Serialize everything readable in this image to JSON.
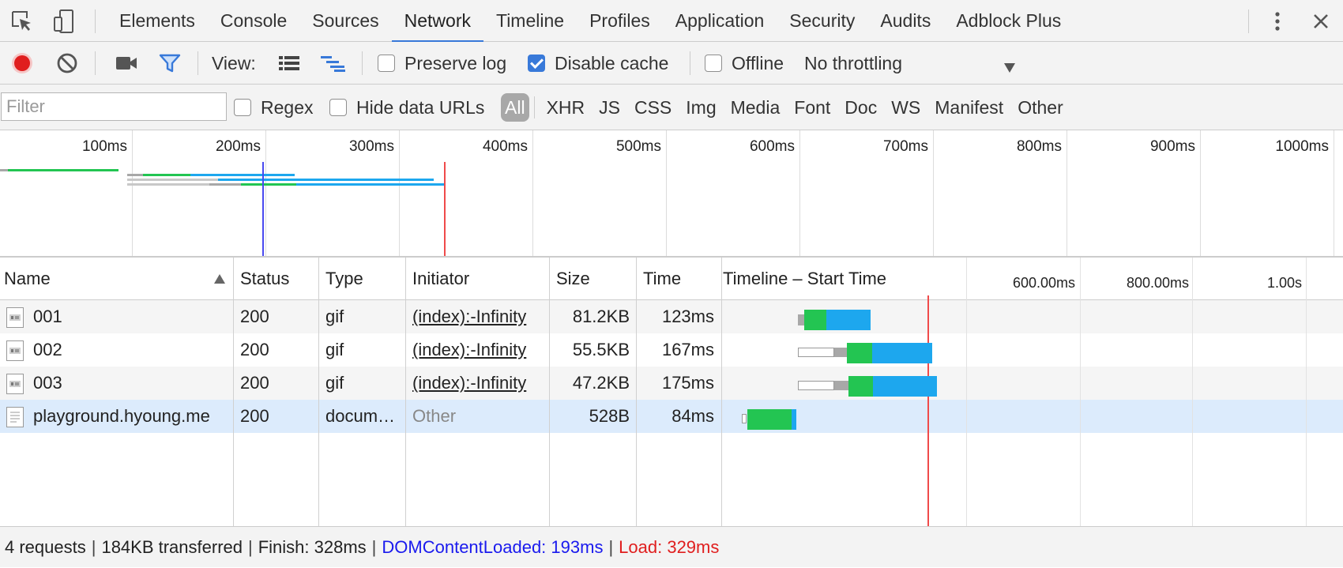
{
  "tabs": [
    {
      "label": "Elements"
    },
    {
      "label": "Console"
    },
    {
      "label": "Sources"
    },
    {
      "label": "Network",
      "selected": true
    },
    {
      "label": "Timeline"
    },
    {
      "label": "Profiles"
    },
    {
      "label": "Application"
    },
    {
      "label": "Security"
    },
    {
      "label": "Audits"
    },
    {
      "label": "Adblock Plus"
    }
  ],
  "toolbar": {
    "view_label": "View:",
    "preserve_log": {
      "label": "Preserve log",
      "checked": false
    },
    "disable_cache": {
      "label": "Disable cache",
      "checked": true
    },
    "offline": {
      "label": "Offline",
      "checked": false
    },
    "throttling": "No throttling",
    "record_color": "#e01e1e",
    "accent_color": "#3879d9"
  },
  "filterbar": {
    "placeholder": "Filter",
    "regex": {
      "label": "Regex",
      "checked": false
    },
    "hide_data_urls": {
      "label": "Hide data URLs",
      "checked": false
    },
    "types": [
      "All",
      "XHR",
      "JS",
      "CSS",
      "Img",
      "Media",
      "Font",
      "Doc",
      "WS",
      "Manifest",
      "Other"
    ],
    "active_type": "All"
  },
  "overview": {
    "ticks": [
      "100ms",
      "200ms",
      "300ms",
      "400ms",
      "500ms",
      "600ms",
      "700ms",
      "800ms",
      "900ms",
      "1000ms"
    ]
  },
  "columns": {
    "name": "Name",
    "status": "Status",
    "type": "Type",
    "initiator": "Initiator",
    "size": "Size",
    "time": "Time",
    "timeline": "Timeline – Start Time",
    "timeline_ticks": [
      "600.00ms",
      "800.00ms",
      "1.00s"
    ]
  },
  "rows": [
    {
      "name": "001",
      "status": "200",
      "type": "gif",
      "initiator": "(index):-Infinity",
      "initiator_link": true,
      "size": "81.2KB",
      "time": "123ms"
    },
    {
      "name": "002",
      "status": "200",
      "type": "gif",
      "initiator": "(index):-Infinity",
      "initiator_link": true,
      "size": "55.5KB",
      "time": "167ms"
    },
    {
      "name": "003",
      "status": "200",
      "type": "gif",
      "initiator": "(index):-Infinity",
      "initiator_link": true,
      "size": "47.2KB",
      "time": "175ms"
    },
    {
      "name": "playground.hyoung.me",
      "status": "200",
      "type": "docum…",
      "initiator": "Other",
      "initiator_link": false,
      "size": "528B",
      "time": "84ms",
      "selected": true
    }
  ],
  "status": {
    "requests": "4 requests",
    "transferred": "184KB transferred",
    "finish": "Finish: 328ms",
    "dom_content_loaded": "DOMContentLoaded: 193ms",
    "load": "Load: 329ms",
    "dcl_color": "#1a1aee",
    "load_color": "#e01e1e"
  },
  "colors": {
    "waiting": "#23c552",
    "download": "#1da7ee",
    "queue": "#a8a8a8"
  }
}
